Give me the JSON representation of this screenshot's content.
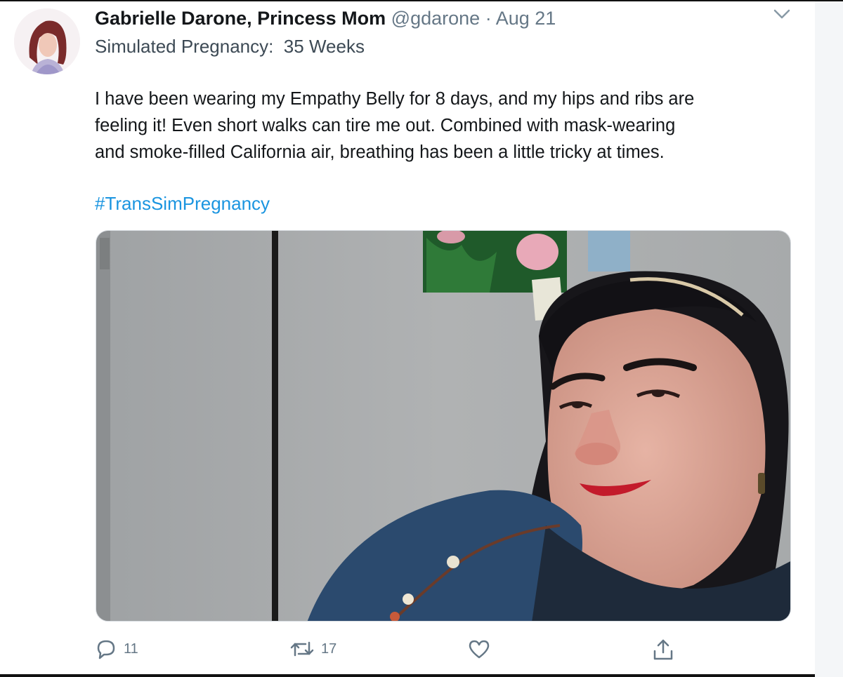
{
  "tweet": {
    "display_name": "Gabrielle Darone, Princess Mom",
    "handle": "@gdarone",
    "separator": "·",
    "date": "Aug 21",
    "subtitle": "Simulated Pregnancy:  35 Weeks",
    "body_lines": [
      "I have been wearing my Empathy Belly for 8 days, and my hips and ribs are",
      "feeling it!  Even short walks can tire me out.  Combined with mask-wearing",
      "and smoke-filled California air, breathing has been a little tricky at times."
    ],
    "hashtag": "#TransSimPregnancy"
  },
  "actions": {
    "reply_count": "11",
    "retweet_count": "17",
    "like_count": "",
    "reply_icon": "reply-icon",
    "retweet_icon": "retweet-icon",
    "like_icon": "heart-icon",
    "share_icon": "share-icon"
  },
  "colors": {
    "link": "#1b95e0",
    "secondary_text": "#657786",
    "primary_text": "#14171a"
  }
}
